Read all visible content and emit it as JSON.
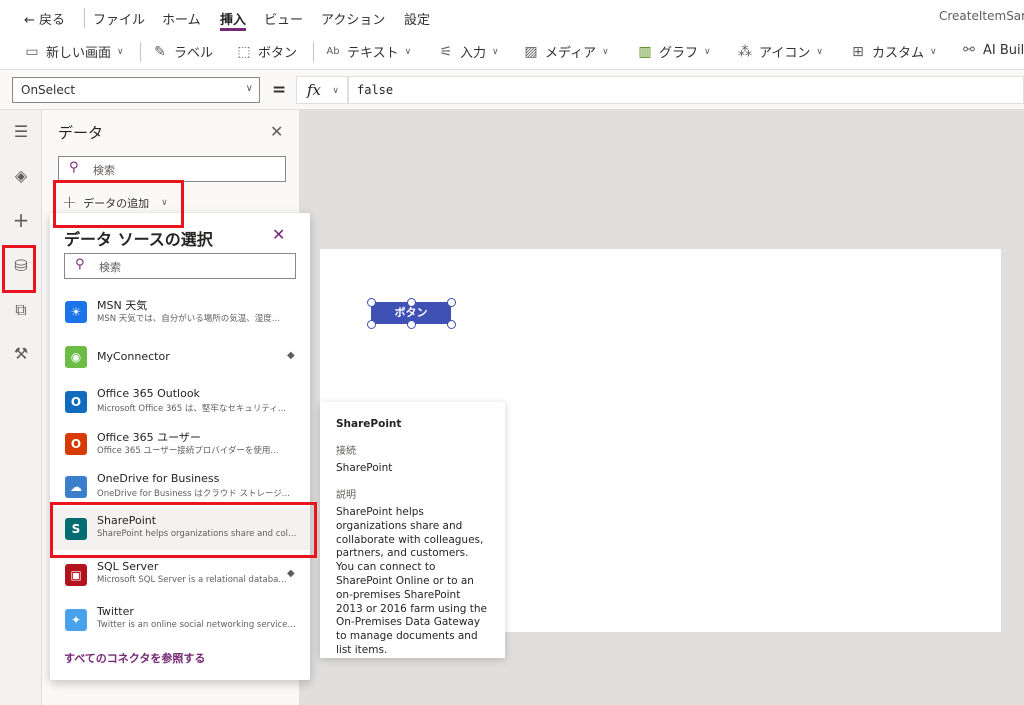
{
  "menubar": {
    "back": "← 戻る",
    "file": "ファイル",
    "home": "ホーム",
    "insert": "挿入",
    "view": "ビュー",
    "action": "アクション",
    "settings": "設定",
    "app_name": "CreateItemSam"
  },
  "toolbar": {
    "new_screen": "新しい画面",
    "label": "ラベル",
    "button": "ボタン",
    "text": "テキスト",
    "input": "入力",
    "media": "メディア",
    "chart": "グラフ",
    "icons": "アイコン",
    "custom": "カスタム",
    "ai_builder": "AI Build"
  },
  "formula": {
    "property": "OnSelect",
    "equals": "=",
    "fx": "fx",
    "value": "false"
  },
  "data_panel": {
    "title": "データ",
    "search_placeholder": "検索",
    "add_data": "データの追加"
  },
  "popup": {
    "title": "データ ソースの選択",
    "search_placeholder": "検索",
    "connectors": [
      {
        "name": "MSN 天気",
        "desc": "MSN 天気では、自分がいる場所の気温、湿度...",
        "color": "#1a73e8",
        "glyph": "☀",
        "premium": false
      },
      {
        "name": "MyConnector",
        "desc": "",
        "color": "#6bbd45",
        "glyph": "◉",
        "premium": true
      },
      {
        "name": "Office 365 Outlook",
        "desc": "Microsoft Office 365 は、堅牢なセキュリティ...",
        "color": "#0f6cbd",
        "glyph": "O",
        "premium": false
      },
      {
        "name": "Office 365 ユーザー",
        "desc": "Office 365 ユーザー接続プロバイダーを使用...",
        "color": "#d83b01",
        "glyph": "O",
        "premium": false
      },
      {
        "name": "OneDrive for Business",
        "desc": "OneDrive for Business はクラウド ストレージ...",
        "color": "#3b7ecb",
        "glyph": "☁",
        "premium": false
      },
      {
        "name": "SharePoint",
        "desc": "SharePoint helps organizations share and colla...",
        "color": "#036c70",
        "glyph": "S",
        "premium": false
      },
      {
        "name": "SQL Server",
        "desc": "Microsoft SQL Server is a relational databa...",
        "color": "#b3131c",
        "glyph": "▣",
        "premium": true
      },
      {
        "name": "Twitter",
        "desc": "Twitter is an online social networking service t...",
        "color": "#4aa1eb",
        "glyph": "✦",
        "premium": false
      }
    ],
    "browse_all": "すべてのコネクタを参照する"
  },
  "canvas": {
    "button_label": "ボタン"
  },
  "card": {
    "title": "SharePoint",
    "connection_label": "接続",
    "connection_value": "SharePoint",
    "description_label": "説明",
    "description": "SharePoint helps organizations share and collaborate with colleagues, partners, and customers. You can connect to SharePoint Online or to an on-premises SharePoint 2013 or 2016 farm using the On-Premises Data Gateway to manage documents and list items."
  },
  "colors": {
    "accent": "#742774",
    "canvas_button": "#3f51b5",
    "highlight": "#e8141e"
  }
}
